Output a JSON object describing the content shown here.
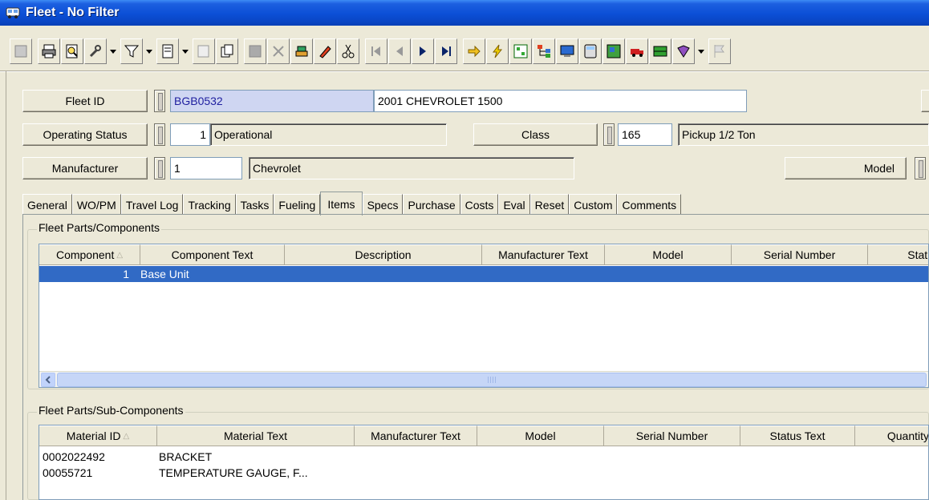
{
  "window": {
    "title": "Fleet - No Filter"
  },
  "header": {
    "fleet_id_label": "Fleet ID",
    "fleet_id_value": "BGB0532",
    "fleet_desc": "2001 CHEVROLET 1500",
    "operating_status_label": "Operating Status",
    "operating_status_code": "1",
    "operating_status_text": "Operational",
    "class_label": "Class",
    "class_code": "165",
    "class_text": "Pickup 1/2 Ton",
    "manufacturer_label": "Manufacturer",
    "manufacturer_code": "1",
    "manufacturer_text": "Chevrolet",
    "model_label": "Model"
  },
  "tabs": [
    "General",
    "WO/PM",
    "Travel Log",
    "Tracking",
    "Tasks",
    "Fueling",
    "Items",
    "Specs",
    "Purchase",
    "Costs",
    "Eval",
    "Reset",
    "Custom",
    "Comments"
  ],
  "active_tab": "Items",
  "components": {
    "group_label": "Fleet Parts/Components",
    "columns": [
      "Component",
      "Component Text",
      "Description",
      "Manufacturer Text",
      "Model",
      "Serial Number",
      "Status"
    ],
    "rows": [
      {
        "component": "1",
        "component_text": "Base Unit"
      }
    ]
  },
  "subcomponents": {
    "group_label": "Fleet Parts/Sub-Components",
    "columns": [
      "Material ID",
      "Material Text",
      "Manufacturer Text",
      "Model",
      "Serial Number",
      "Status Text",
      "Quantity"
    ],
    "rows": [
      {
        "material_id": "0002022492",
        "material_text": "BRACKET"
      },
      {
        "material_id": "00055721",
        "material_text": "TEMPERATURE GAUGE, F..."
      }
    ]
  },
  "icons": [
    "bus-icon",
    "print-icon",
    "preview-icon",
    "tools-icon",
    "filter-icon",
    "report-icon",
    "properties-icon",
    "copy-icon",
    "save-icon",
    "delete-icon",
    "stack-icon",
    "pencil-icon",
    "scissors-icon",
    "first-icon",
    "prev-icon",
    "next-icon",
    "last-icon",
    "arrow-icon",
    "lightning-icon"
  ]
}
